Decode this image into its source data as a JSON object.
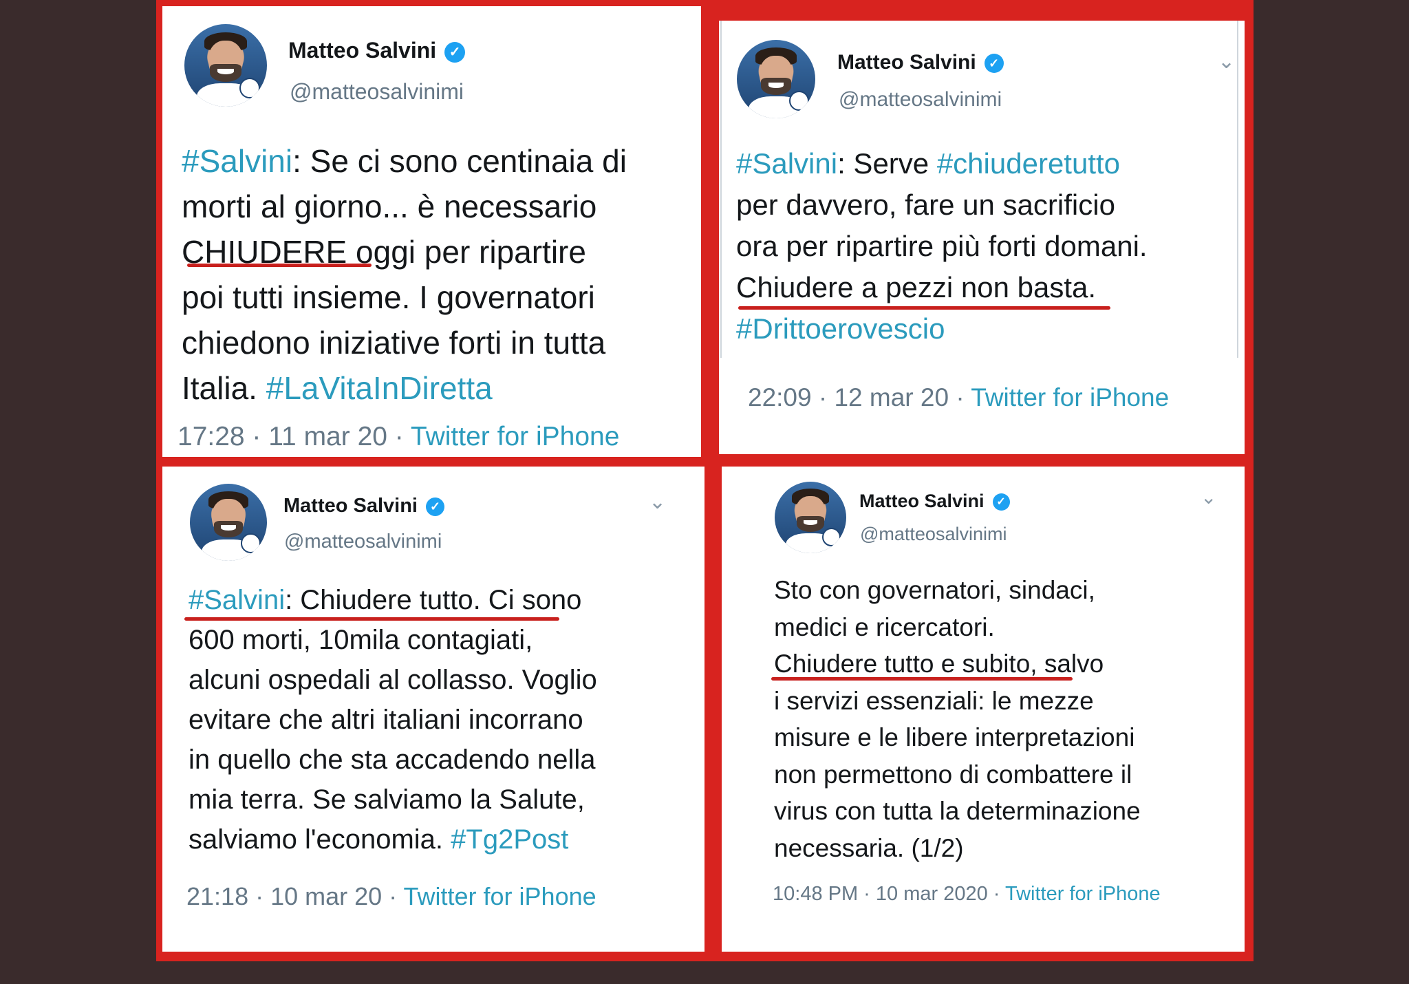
{
  "tweets": [
    {
      "name": "Matteo Salvini",
      "handle": "@matteosalvinimi",
      "lines": [
        [
          {
            "t": "#Salvini",
            "tag": true
          },
          {
            "t": ": Se ci sono centinaia di"
          }
        ],
        [
          {
            "t": "morti al giorno... è necessario"
          }
        ],
        [
          {
            "t": "CHIUDERE oggi per ripartire"
          }
        ],
        [
          {
            "t": "poi tutti insieme. I governatori"
          }
        ],
        [
          {
            "t": "chiedono iniziative forti in tutta"
          }
        ],
        [
          {
            "t": "Italia. "
          },
          {
            "t": "#LaVitaInDiretta",
            "tag": true
          }
        ]
      ],
      "time": "17:28 · 11 mar 20 · ",
      "source": "Twitter for iPhone"
    },
    {
      "name": "Matteo Salvini",
      "handle": "@matteosalvinimi",
      "chevron": "chevron-down-icon",
      "lines": [
        [
          {
            "t": "#Salvini",
            "tag": true
          },
          {
            "t": ": Serve "
          },
          {
            "t": "#chiuderetutto",
            "tag": true
          }
        ],
        [
          {
            "t": "per davvero, fare un sacrificio"
          }
        ],
        [
          {
            "t": "ora per ripartire più forti domani."
          }
        ],
        [
          {
            "t": "Chiudere a pezzi non basta."
          }
        ],
        [
          {
            "t": "#Drittoerovescio",
            "tag": true
          }
        ]
      ],
      "time": "22:09 · 12 mar 20 · ",
      "source": "Twitter for iPhone"
    },
    {
      "name": "Matteo Salvini",
      "handle": "@matteosalvinimi",
      "chevron": "chevron-down-icon",
      "lines": [
        [
          {
            "t": "#Salvini",
            "tag": true
          },
          {
            "t": ": Chiudere tutto. Ci sono"
          }
        ],
        [
          {
            "t": "600 morti, 10mila contagiati,"
          }
        ],
        [
          {
            "t": "alcuni ospedali al collasso. Voglio"
          }
        ],
        [
          {
            "t": "evitare che altri italiani incorrano"
          }
        ],
        [
          {
            "t": "in quello che sta accadendo nella"
          }
        ],
        [
          {
            "t": "mia terra. Se salviamo la Salute,"
          }
        ],
        [
          {
            "t": "salviamo l'economia. "
          },
          {
            "t": "#Tg2Post",
            "tag": true
          }
        ]
      ],
      "time": "21:18 · 10 mar 20 · ",
      "source": "Twitter for iPhone"
    },
    {
      "name": "Matteo Salvini",
      "handle": "@matteosalvinimi",
      "chevron": "chevron-down-icon",
      "lines": [
        [
          {
            "t": "Sto con governatori, sindaci,"
          }
        ],
        [
          {
            "t": "medici e ricercatori."
          }
        ],
        [
          {
            "t": "Chiudere tutto e subito, salvo"
          }
        ],
        [
          {
            "t": "i servizi essenziali: le mezze"
          }
        ],
        [
          {
            "t": "misure e le libere interpretazioni"
          }
        ],
        [
          {
            "t": "non permettono di combattere il"
          }
        ],
        [
          {
            "t": "virus con tutta la determinazione"
          }
        ],
        [
          {
            "t": "necessaria. (1/2)"
          }
        ]
      ],
      "time": "10:48 PM · 10 mar 2020 · ",
      "source": "Twitter for iPhone"
    }
  ],
  "colors": {
    "frame": "#d8231f",
    "background": "#3a2b2c",
    "hashtag": "#2b9bbd",
    "verified": "#1da1f2",
    "underline": "#c8201d"
  }
}
